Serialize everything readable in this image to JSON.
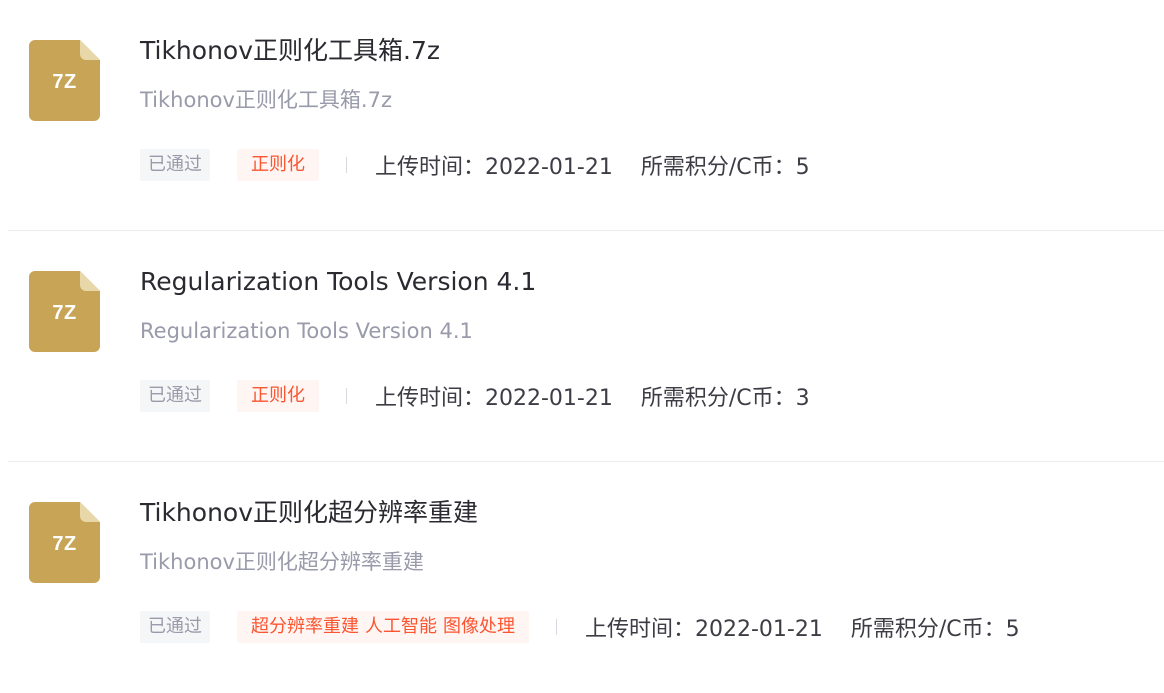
{
  "resources": [
    {
      "file_ext": "7Z",
      "title": "Tikhonov正则化工具箱.7z",
      "description": "Tikhonov正则化工具箱.7z",
      "status": "已通过",
      "tags": [
        "正则化"
      ],
      "upload_time": "上传时间：2022-01-21",
      "points": "所需积分/C币：5"
    },
    {
      "file_ext": "7Z",
      "title": "Regularization Tools Version 4.1",
      "description": "Regularization Tools Version 4.1",
      "status": "已通过",
      "tags": [
        "正则化"
      ],
      "upload_time": "上传时间：2022-01-21",
      "points": "所需积分/C币：3"
    },
    {
      "file_ext": "7Z",
      "title": "Tikhonov正则化超分辨率重建",
      "description": "Tikhonov正则化超分辨率重建",
      "status": "已通过",
      "tags": [
        "超分辨率重建",
        "人工智能",
        "图像处理"
      ],
      "upload_time": "上传时间：2022-01-21",
      "points": "所需积分/C币：5"
    }
  ],
  "colors": {
    "file_icon": "#c7a456",
    "file_icon_fold": "#e8d7a8",
    "tag_text": "#fc5531",
    "tag_bg": "#fff5f2",
    "status_bg": "#f5f6f7"
  },
  "icons": {
    "file": "file-7z-icon"
  }
}
